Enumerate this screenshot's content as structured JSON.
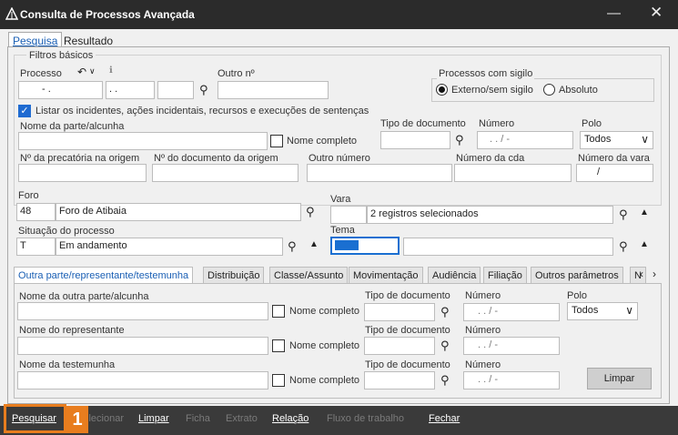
{
  "window": {
    "title": "Consulta de Processos Avançada"
  },
  "tabs": [
    {
      "label": "Pesquisa"
    },
    {
      "label": "Resultado"
    }
  ],
  "filters": {
    "group_title": "Filtros básicos",
    "processo": {
      "label": "Processo",
      "part1": "-  .",
      "part2": ".  .",
      "part3": ""
    },
    "outro": {
      "label": "Outro nº",
      "value": ""
    },
    "sigilo": {
      "title": "Processos com sigilo",
      "opt1": "Externo/sem sigilo",
      "opt2": "Absoluto"
    },
    "listar": {
      "label": "Listar os incidentes, ações incidentais, recursos e execuções de sentenças"
    },
    "parte": {
      "label": "Nome da parte/alcunha",
      "value": "",
      "nome_completo": "Nome completo"
    },
    "tipo_doc": {
      "label": "Tipo de documento",
      "value": ""
    },
    "numero": {
      "label": "Número",
      "value": ".  .  /  -"
    },
    "polo": {
      "label": "Polo",
      "value": "Todos"
    },
    "precatoria": {
      "label": "Nº da precatória na origem"
    },
    "doc_origem": {
      "label": "Nº do documento da origem"
    },
    "outro_numero": {
      "label": "Outro número"
    },
    "numero_cda": {
      "label": "Número da cda"
    },
    "numero_vara": {
      "label": "Número da vara",
      "value": "/"
    }
  },
  "foro": {
    "label": "Foro",
    "code": "48",
    "name": "Foro de Atibaia"
  },
  "vara": {
    "label": "Vara",
    "code": "",
    "name": "2 registros selecionados"
  },
  "situacao": {
    "label": "Situação do processo",
    "code": "T",
    "name": "Em andamento"
  },
  "tema": {
    "label": "Tema",
    "code": "",
    "name": ""
  },
  "subtabs": [
    {
      "label": "Outra parte/representante/testemunha"
    },
    {
      "label": "Distribuição"
    },
    {
      "label": "Classe/Assunto"
    },
    {
      "label": "Movimentação"
    },
    {
      "label": "Audiência"
    },
    {
      "label": "Filiação"
    },
    {
      "label": "Outros parâmetros"
    },
    {
      "label": "N"
    }
  ],
  "other": {
    "outra_parte": {
      "label": "Nome da outra parte/alcunha"
    },
    "representante": {
      "label": "Nome do representante"
    },
    "testemunha": {
      "label": "Nome da testemunha"
    },
    "nome_completo": "Nome completo",
    "tipo_doc": "Tipo de documento",
    "numero": "Número",
    "numero_value": ".  .  /  -",
    "polo": "Polo",
    "polo_value": "Todos",
    "limpar": "Limpar"
  },
  "bottom": {
    "pesquisar": "Pesquisar",
    "selecionar": "Selecionar",
    "limpar": "Limpar",
    "ficha": "Ficha",
    "extrato": "Extrato",
    "relacao": "Relação",
    "fluxo": "Fluxo de trabalho",
    "fechar": "Fechar",
    "callout": "1",
    "callout_color": "#e87d1e"
  }
}
